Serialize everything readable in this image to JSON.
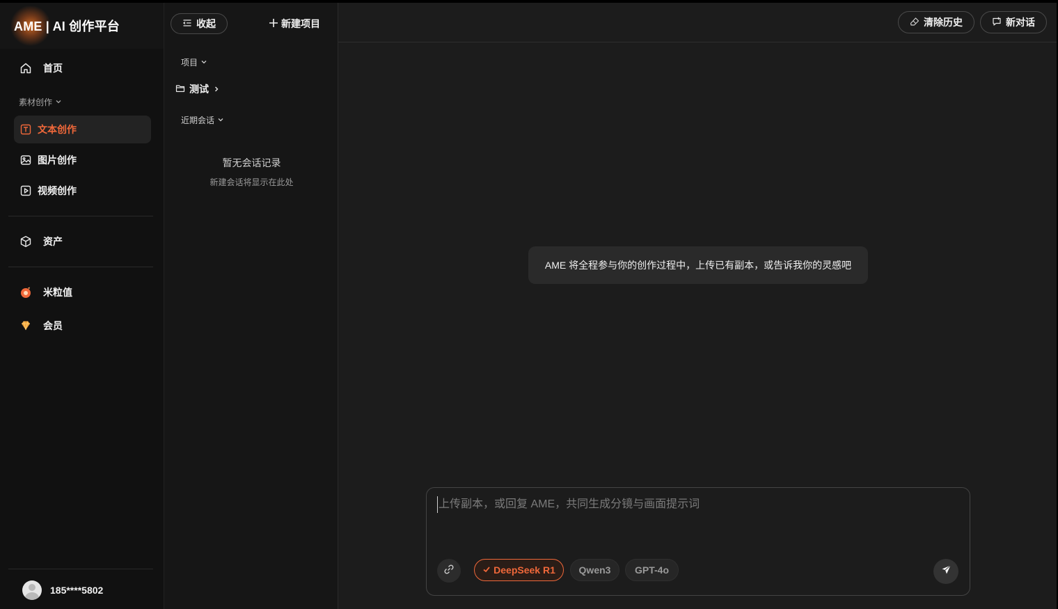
{
  "brand": {
    "title": "AME | AI 创作平台"
  },
  "sidebar": {
    "home_label": "首页",
    "section_label": "素材创作",
    "items": [
      {
        "label": "文本创作",
        "icon": "text-icon",
        "active": true
      },
      {
        "label": "图片创作",
        "icon": "image-icon",
        "active": false
      },
      {
        "label": "视频创作",
        "icon": "video-icon",
        "active": false
      }
    ],
    "assets_label": "资产",
    "coins_label": "米粒值",
    "member_label": "会员",
    "user": {
      "name": "185****5802"
    }
  },
  "panel": {
    "collapse_label": "收起",
    "new_project_label": "新建项目",
    "projects_label": "项目",
    "folder_label": "测试",
    "recent_label": "近期会话",
    "empty_title": "暂无会话记录",
    "empty_subtitle": "新建会话将显示在此处"
  },
  "main": {
    "clear_history_label": "清除历史",
    "new_chat_label": "新对话",
    "welcome_message": "AME 将全程参与你的创作过程中，上传已有副本，或告诉我你的灵感吧",
    "composer": {
      "placeholder": "上传副本，或回复 AME，共同生成分镜与画面提示词",
      "value": "",
      "models": [
        {
          "label": "DeepSeek R1",
          "selected": true
        },
        {
          "label": "Qwen3",
          "selected": false
        },
        {
          "label": "GPT-4o",
          "selected": false
        }
      ]
    }
  },
  "colors": {
    "accent": "#f0683a",
    "background": "#1c1c1c",
    "sidebar": "#111111"
  }
}
